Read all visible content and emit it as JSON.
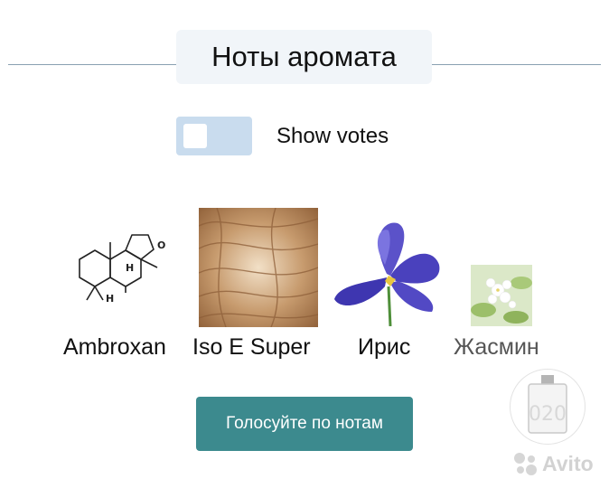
{
  "section": {
    "title": "Ноты аромата"
  },
  "toggle": {
    "label": "Show votes",
    "on": false
  },
  "notes": [
    {
      "name": "Ambroxan",
      "icon": "molecule-structure"
    },
    {
      "name": "Iso E Super",
      "icon": "wood-texture"
    },
    {
      "name": "Ирис",
      "icon": "iris-flower"
    },
    {
      "name": "Жасмин",
      "icon": "jasmine-flower"
    }
  ],
  "vote_button": {
    "label": "Голосуйте по нотам"
  },
  "thumbnail": {
    "text": "020"
  },
  "watermark": {
    "text": "Avito"
  },
  "colors": {
    "accent": "#3c8a8e",
    "toggle_bg": "#c9dcee",
    "title_bg": "#f1f5f9",
    "rule": "#8aa0b2"
  }
}
